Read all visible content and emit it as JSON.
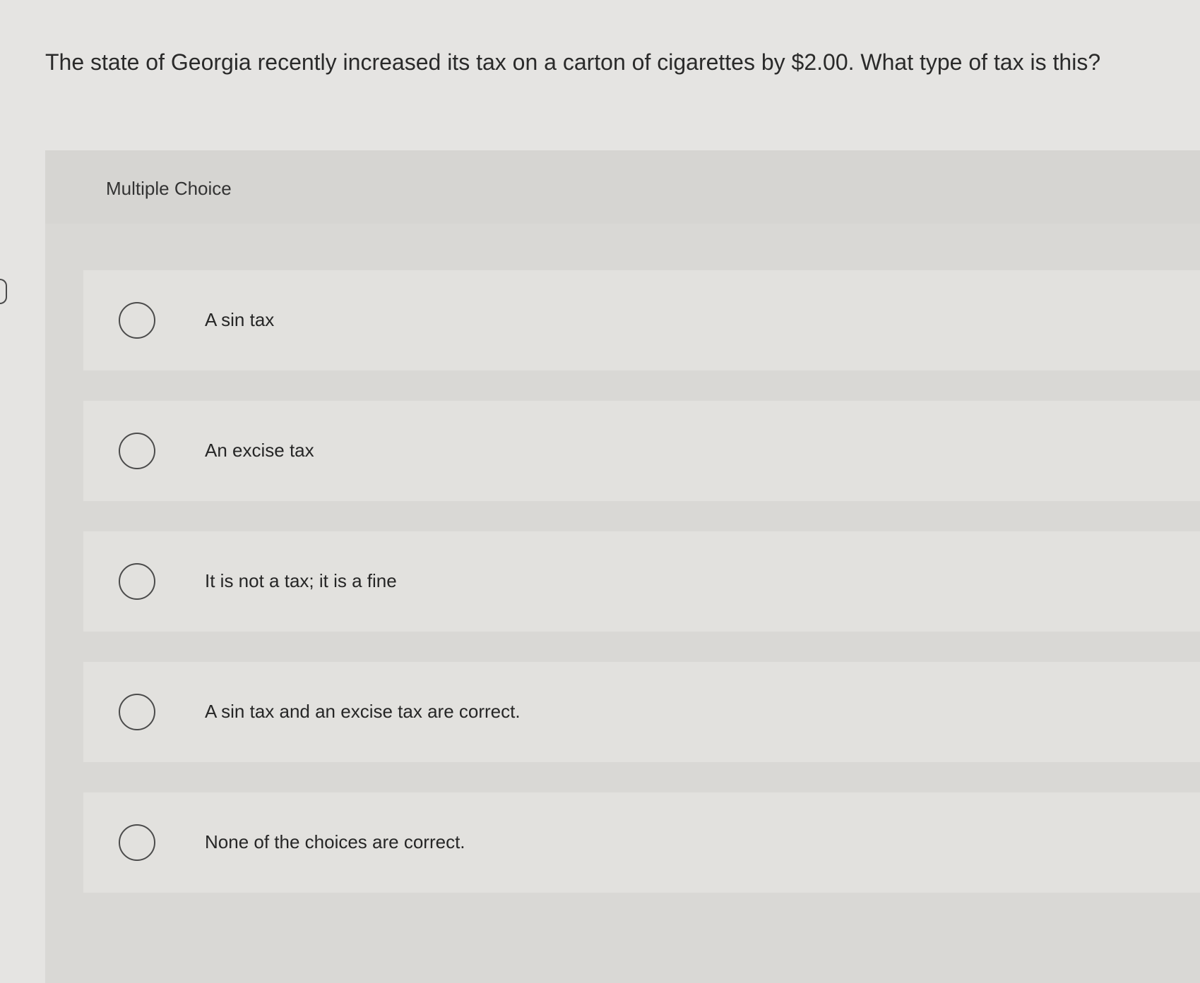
{
  "question": {
    "text": "The state of Georgia recently increased its tax on a carton of cigarettes by $2.00. What type of tax is this?"
  },
  "choice_panel": {
    "heading": "Multiple Choice",
    "options": [
      {
        "label": "A sin tax",
        "selected": false
      },
      {
        "label": "An excise tax",
        "selected": false
      },
      {
        "label": "It is not a tax; it is a fine",
        "selected": false
      },
      {
        "label": "A sin tax and an excise tax are correct.",
        "selected": false
      },
      {
        "label": "None of the choices are correct.",
        "selected": false
      }
    ]
  },
  "colors": {
    "page_background": "#e5e4e2",
    "panel_background": "#d9d8d5",
    "option_background": "#e2e1de",
    "text": "#2a2a2a",
    "radio_border": "#4b4b4b"
  }
}
